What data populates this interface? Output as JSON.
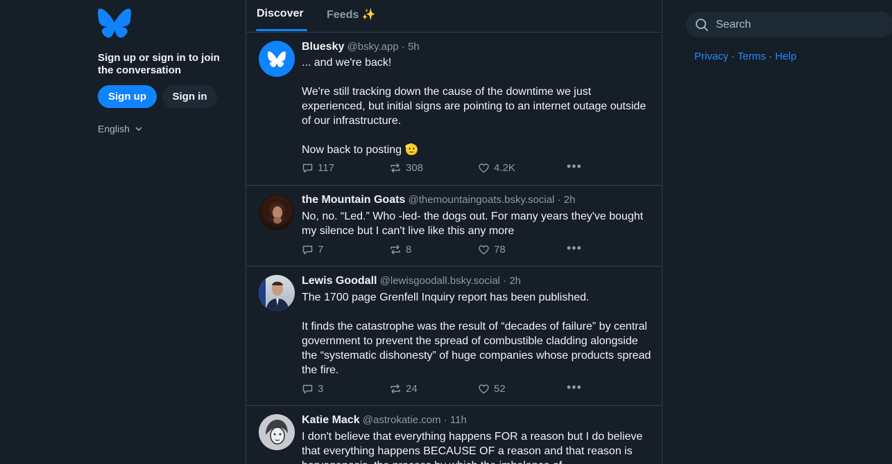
{
  "left": {
    "tagline": "Sign up or sign in to join the conversation",
    "signup_label": "Sign up",
    "signin_label": "Sign in",
    "language": "English"
  },
  "tabs": [
    {
      "label": "Discover",
      "active": true
    },
    {
      "label": "Feeds ✨",
      "active": false
    }
  ],
  "posts": [
    {
      "author": "Bluesky",
      "handle": "@bsky.app",
      "time": "5h",
      "paragraphs": [
        "... and we're back!",
        "We're still tracking down the cause of the downtime we just experienced, but initial signs are pointing to an internet outage outside of our infrastructure.",
        "Now back to posting 🫡"
      ],
      "replies": "117",
      "reposts": "308",
      "likes": "4.2K"
    },
    {
      "author": "the Mountain Goats",
      "handle": "@themountaingoats.bsky.social",
      "time": "2h",
      "paragraphs": [
        "No, no. “Led.” Who -led- the dogs out. For many years they've bought my silence but I can't live like this any more"
      ],
      "replies": "7",
      "reposts": "8",
      "likes": "78"
    },
    {
      "author": "Lewis Goodall",
      "handle": "@lewisgoodall.bsky.social",
      "time": "2h",
      "paragraphs": [
        "The 1700 page Grenfell Inquiry report has been published.",
        "It finds the catastrophe was the result of “decades of failure” by central government to prevent the spread of combustible cladding alongside the “systematic dishonesty” of huge companies whose products spread the fire."
      ],
      "replies": "3",
      "reposts": "24",
      "likes": "52"
    },
    {
      "author": "Katie Mack",
      "handle": "@astrokatie.com",
      "time": "11h",
      "paragraphs": [
        "I don't believe that everything happens FOR a reason but I do believe that everything happens BECAUSE OF a reason and that reason is baryogenesis, the process by which the imbalance of"
      ]
    }
  ],
  "search": {
    "placeholder": "Search"
  },
  "footer_links": [
    "Privacy",
    "Terms",
    "Help"
  ],
  "colors": {
    "accent": "#1083fe",
    "background": "#161e27",
    "link": "#208bfe"
  }
}
